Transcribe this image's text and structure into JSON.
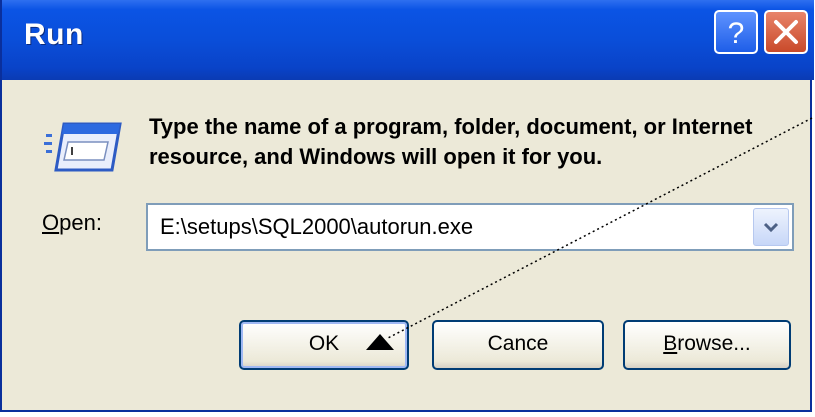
{
  "window": {
    "title": "Run"
  },
  "titlebar": {
    "help_icon": "question-mark-icon",
    "close_icon": "close-x-icon"
  },
  "dialog": {
    "description": "Type the name of a program, folder, document, or Internet resource, and Windows will open it for you.",
    "icon": "run-program-icon"
  },
  "open_field": {
    "label_mnemonic": "O",
    "label_rest": "pen:",
    "value": "E:\\setups\\SQL2000\\autorun.exe",
    "dropdown_icon": "chevron-down-icon"
  },
  "buttons": {
    "ok_label": "OK",
    "cancel_label": "Cance",
    "browse_mnemonic": "B",
    "browse_rest": "rowse..."
  },
  "colors": {
    "titlebar": "#0a4ed9",
    "dialog_bg": "#ece9d8",
    "close_red": "#c94a2a",
    "help_blue": "#1e5ee8"
  }
}
